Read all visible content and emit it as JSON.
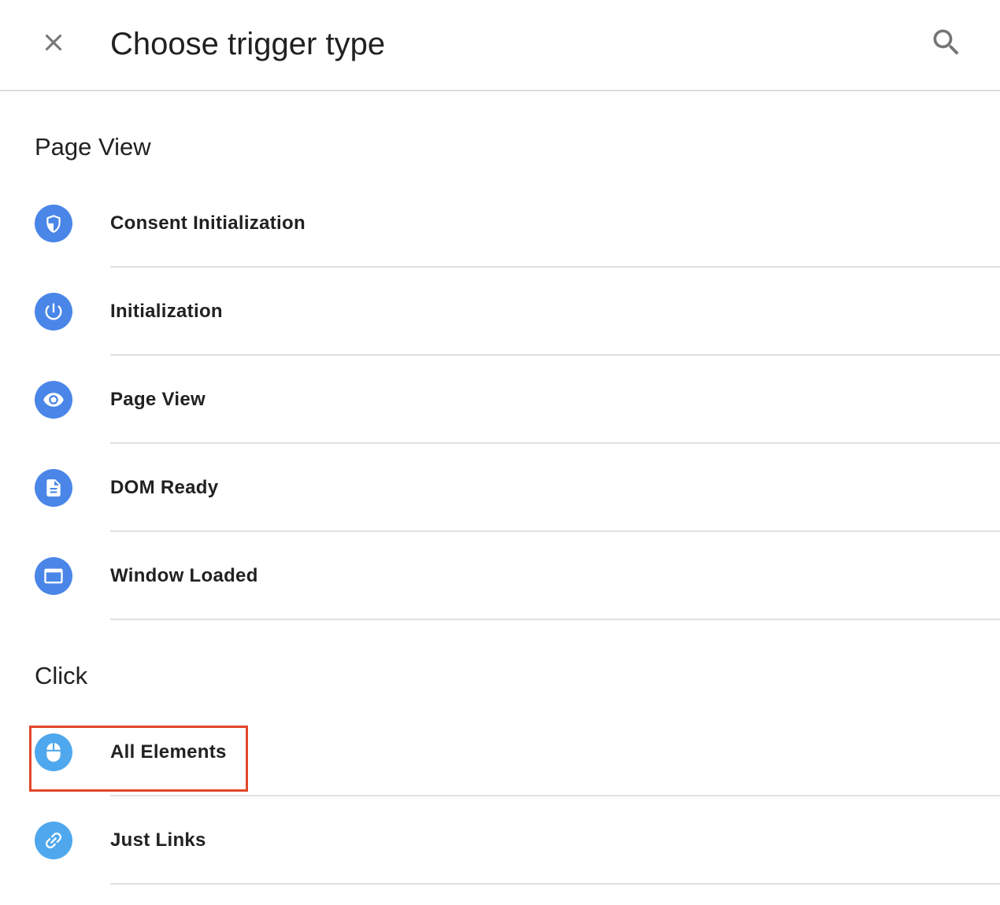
{
  "header": {
    "title": "Choose trigger type",
    "close_icon": "close-icon",
    "search_icon": "search-icon"
  },
  "colors": {
    "icon_blue": "#4a86e8",
    "icon_light_blue": "#4fa8ee",
    "highlight": "#e2462a",
    "divider": "#e0e0e0"
  },
  "sections": [
    {
      "title": "Page View",
      "items": [
        {
          "label": "Consent Initialization",
          "icon": "shield-icon"
        },
        {
          "label": "Initialization",
          "icon": "power-icon"
        },
        {
          "label": "Page View",
          "icon": "eye-icon"
        },
        {
          "label": "DOM Ready",
          "icon": "document-icon"
        },
        {
          "label": "Window Loaded",
          "icon": "window-icon"
        }
      ]
    },
    {
      "title": "Click",
      "items": [
        {
          "label": "All Elements",
          "icon": "mouse-icon",
          "highlighted": true
        },
        {
          "label": "Just Links",
          "icon": "link-icon"
        }
      ]
    }
  ]
}
